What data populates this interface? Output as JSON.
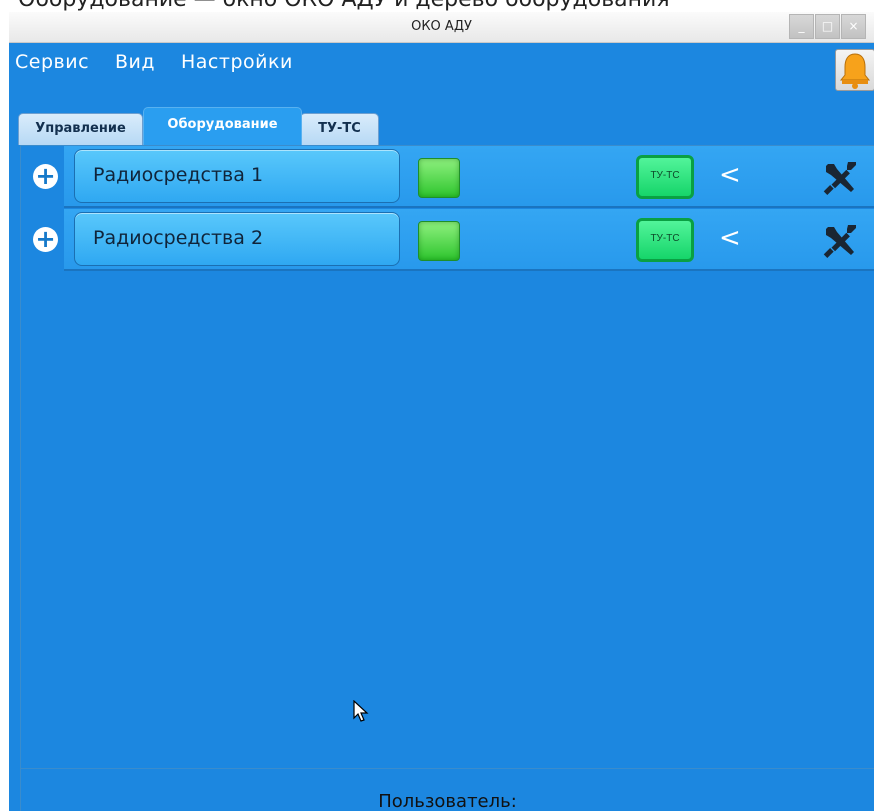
{
  "background_text": "Оборудование — окно ОКО АДУ и дерево оборудования",
  "window": {
    "title": "ОКО АДУ",
    "controls": {
      "minimize": "_",
      "maximize": "□",
      "close": "×"
    }
  },
  "menu": [
    {
      "label": "Сервис"
    },
    {
      "label": "Вид"
    },
    {
      "label": "Настройки"
    }
  ],
  "tabs": [
    {
      "label": "Управление"
    },
    {
      "label": "Оборудование",
      "active": true
    },
    {
      "label": "ТУ-ТС"
    }
  ],
  "rows": [
    {
      "name": "Радиосредства 1",
      "tutc_label": "ТУ-ТС",
      "status_color": "#2ec52e",
      "chevron": "<"
    },
    {
      "name": "Радиосредства 2",
      "tutc_label": "ТУ-ТС",
      "status_color": "#2ec52e",
      "chevron": "<"
    }
  ],
  "status": {
    "label": "Пользователь:"
  },
  "icons": {
    "add": "plus-icon",
    "bell": "bell-icon",
    "tools": "wrench-screwdriver-icon"
  },
  "colors": {
    "window_bg": "#1c87e0",
    "accent": "#2a9ef0",
    "led": "#2ec52e"
  }
}
